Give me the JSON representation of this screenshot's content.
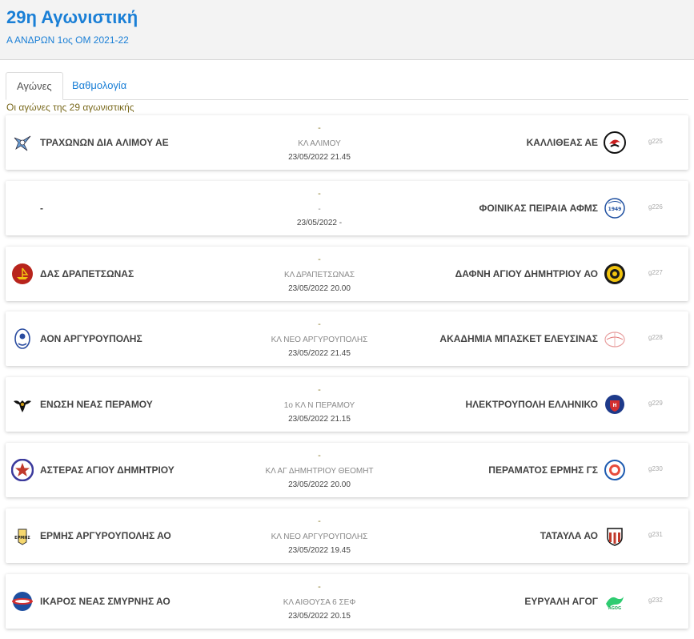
{
  "header": {
    "title": "29η Αγωνιστική",
    "subtitle": "Α ΑΝΔΡΩΝ 1ος ΟΜ 2021-22"
  },
  "tabs": [
    {
      "label": "Αγώνες",
      "active": true
    },
    {
      "label": "Βαθμολογία",
      "active": false
    }
  ],
  "info_text": "Οι αγώνες της 29 αγωνιστικής",
  "colors": {
    "accent": "#1a7fd6",
    "info": "#7a6a1e",
    "header_bg": "#f3f3f3"
  },
  "matches": [
    {
      "home": "ΤΡΑΧΩΝΩΝ ΔΙΑ ΑΛΙΜΟΥ ΑΕ",
      "home_icon": "wings-logo-icon",
      "away": "ΚΑΛΛΙΘΕΑΣ ΑΕ",
      "away_icon": "eagle-logo-icon",
      "score": "-",
      "venue": "ΚΛ ΑΛΙΜΟΥ",
      "datetime": "23/05/2022 21.45",
      "code": "g225"
    },
    {
      "home": "-",
      "home_icon": "",
      "away": "ΦΟΙΝΙΚΑΣ ΠΕΙΡΑΙΑ ΑΦΜΣ",
      "away_icon": "phoenix-1949-logo-icon",
      "score": "-",
      "venue": "-",
      "datetime": "23/05/2022 -",
      "code": "g226"
    },
    {
      "home": "ΔΑΣ ΔΡΑΠΕΤΣΩΝΑΣ",
      "home_icon": "ship-logo-icon",
      "away": "ΔΑΦΝΗ ΑΓΙΟΥ ΔΗΜΗΤΡΙΟΥ ΑΟ",
      "away_icon": "daphne-logo-icon",
      "score": "-",
      "venue": "ΚΛ ΔΡΑΠΕΤΣΩΝΑΣ",
      "datetime": "23/05/2022 20.00",
      "code": "g227"
    },
    {
      "home": "ΑΟΝ ΑΡΓΥΡΟΥΠΟΛΗΣ",
      "home_icon": "wreath-logo-icon",
      "away": "ΑΚΑΔΗΜΙΑ ΜΠΑΣΚΕΤ ΕΛΕΥΣΙΝΑΣ",
      "away_icon": "basketball-logo-icon",
      "score": "-",
      "venue": "ΚΛ ΝΕΟ ΑΡΓΥΡΟΥΠΟΛΗΣ",
      "datetime": "23/05/2022 21.45",
      "code": "g228"
    },
    {
      "home": "ΕΝΩΣΗ ΝΕΑΣ ΠΕΡΑΜΟΥ",
      "home_icon": "double-eagle-logo-icon",
      "away": "ΗΛΕΚΤΡΟΥΠΟΛΗ ΕΛΛΗΝΙΚΟ",
      "away_icon": "shield-logo-icon",
      "score": "-",
      "venue": "1ο ΚΛ Ν ΠΕΡΑΜΟΥ",
      "datetime": "23/05/2022 21.15",
      "code": "g229"
    },
    {
      "home": "ΑΣΤΕΡΑΣ ΑΓΙΟΥ ΔΗΜΗΤΡΙΟΥ",
      "home_icon": "star-logo-icon",
      "away": "ΠΕΡΑΜΑΤΟΣ ΕΡΜΗΣ ΓΣ",
      "away_icon": "round-badge-logo-icon",
      "score": "-",
      "venue": "ΚΛ ΑΓ ΔΗΜΗΤΡΙΟΥ ΘΕΟΜΗΤ",
      "datetime": "23/05/2022 20.00",
      "code": "g230"
    },
    {
      "home": "ΕΡΜΗΣ ΑΡΓΥΡΟΥΠΟΛΗΣ ΑΟ",
      "home_icon": "hermes-logo-icon",
      "away": "ΤΑΤΑΥΛΑ ΑΟ",
      "away_icon": "striped-shield-logo-icon",
      "score": "-",
      "venue": "ΚΛ ΝΕΟ ΑΡΓΥΡΟΥΠΟΛΗΣ",
      "datetime": "23/05/2022 19.45",
      "code": "g231"
    },
    {
      "home": "ΙΚΑΡΟΣ ΝΕΑΣ ΣΜΥΡΝΗΣ ΑΟ",
      "home_icon": "ikaros-logo-icon",
      "away": "ΕΥΡΥΑΛΗ ΑΓΟΓ",
      "away_icon": "green-wave-logo-icon",
      "score": "-",
      "venue": "ΚΛ ΑΙΘΟΥΣΑ 6 ΣΕΦ",
      "datetime": "23/05/2022 20.15",
      "code": "g232"
    }
  ]
}
